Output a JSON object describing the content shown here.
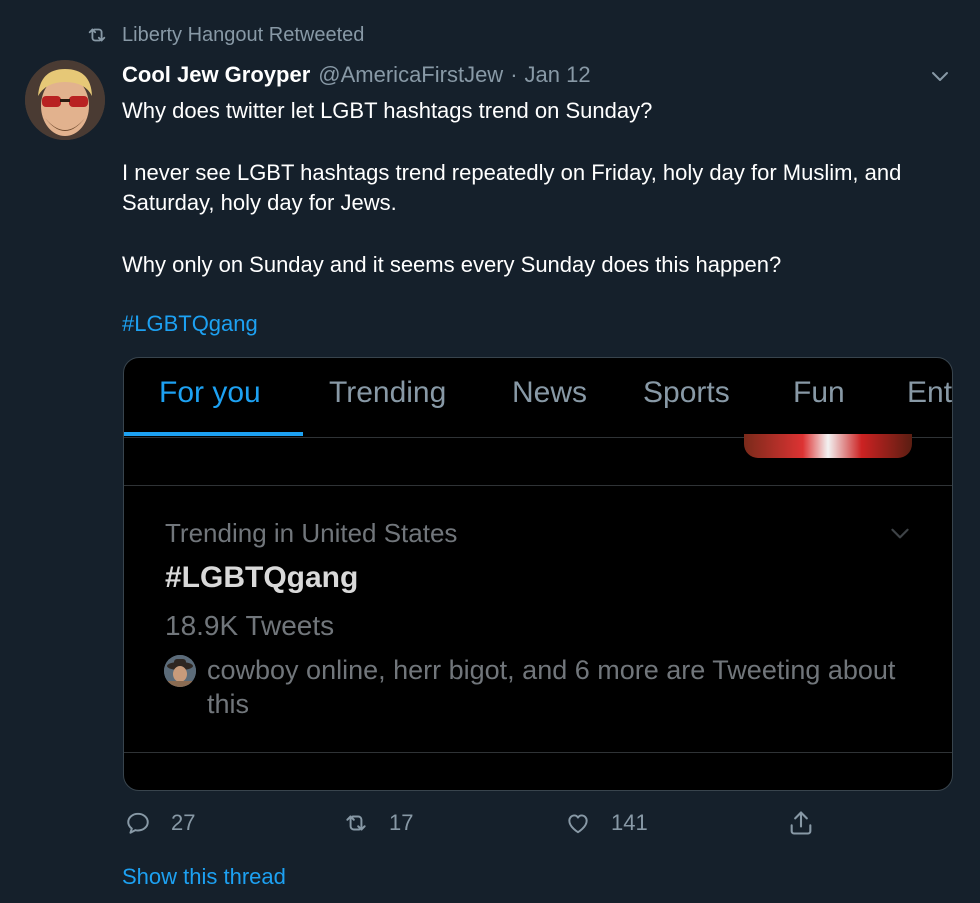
{
  "retweet_bar": {
    "text": "Liberty Hangout Retweeted"
  },
  "tweet": {
    "author": "Cool Jew Groyper",
    "handle": "@AmericaFirstJew",
    "separator": "·",
    "date": "Jan 12",
    "paragraphs": [
      "Why does twitter let LGBT hashtags trend on Sunday?",
      "I never see LGBT hashtags trend repeatedly on Friday, holy day for Muslim, and Saturday, holy day for Jews.",
      "Why only on Sunday and it seems every Sunday does this happen?"
    ],
    "hashtag": "#LGBTQgang"
  },
  "embed": {
    "tabs": [
      {
        "label": "For you",
        "active": true
      },
      {
        "label": "Trending",
        "active": false
      },
      {
        "label": "News",
        "active": false
      },
      {
        "label": "Sports",
        "active": false
      },
      {
        "label": "Fun",
        "active": false
      },
      {
        "label": "Ent",
        "active": false
      }
    ],
    "trend": {
      "context": "Trending in United States",
      "name": "#LGBTQgang",
      "count": "18.9K Tweets",
      "social_context": "cowboy online, herr bigot, and 6 more are Tweeting about this"
    }
  },
  "actions": {
    "replies": "27",
    "retweets": "17",
    "likes": "141"
  },
  "show_thread": "Show this thread",
  "colors": {
    "background": "#15202b",
    "accent": "#1da1f2",
    "secondary_text": "#8899a6",
    "embed_background": "#000000"
  }
}
